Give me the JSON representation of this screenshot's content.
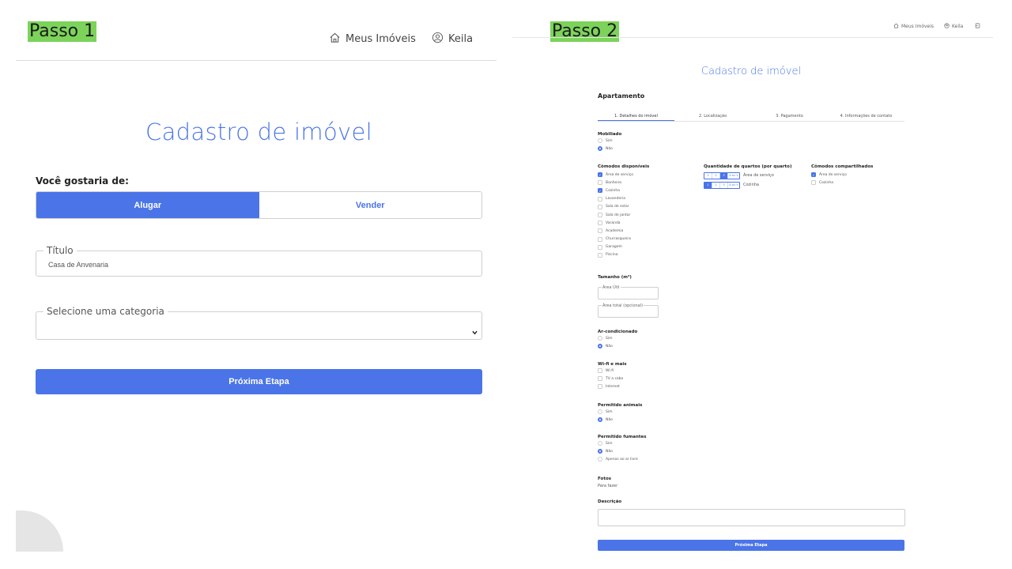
{
  "left": {
    "step_label": "Passo 1",
    "nav": {
      "home_label": "Meus Imóveis",
      "user_label": "Keila"
    },
    "title": "Cadastro de imóvel",
    "question": "Você gostaria de:",
    "toggle": {
      "rent": "Alugar",
      "sell": "Vender"
    },
    "titulo": {
      "legend": "Título",
      "value": "Casa de Anvenaria"
    },
    "categoria": {
      "legend": "Selecione uma categoria",
      "value": ""
    },
    "next_button": "Próxima Etapa"
  },
  "right": {
    "step_label": "Passo 2",
    "nav": {
      "home_label": "Meus Imóveis",
      "user_label": "Keila"
    },
    "title": "Cadastro de imóvel",
    "subtitle": "Apartamento",
    "tabs": [
      "1. Detalhes do imóvel",
      "2. Localização",
      "3. Pagamento",
      "4. Informações de contato"
    ],
    "mobiliado": {
      "label": "Mobiliado",
      "options": [
        "Sim",
        "Não"
      ],
      "selected": 1
    },
    "comodos": {
      "label": "Cômodos disponíveis",
      "items": [
        {
          "label": "Área de serviço",
          "checked": true
        },
        {
          "label": "Banheiro",
          "checked": false
        },
        {
          "label": "Cozinha",
          "checked": true
        },
        {
          "label": "Lavanderia",
          "checked": false
        },
        {
          "label": "Sala de estar",
          "checked": false
        },
        {
          "label": "Sala de jantar",
          "checked": false
        },
        {
          "label": "Varanda",
          "checked": false
        },
        {
          "label": "Academia",
          "checked": false
        },
        {
          "label": "Churrasqueira",
          "checked": false
        },
        {
          "label": "Garagem",
          "checked": false
        },
        {
          "label": "Piscina",
          "checked": false
        }
      ]
    },
    "quartos": {
      "label": "Quantidade de quartos (por quarto)",
      "rows": [
        {
          "label": "Área de serviço",
          "options": [
            "1",
            "2",
            "3",
            "4 ou +"
          ],
          "selected": 2
        },
        {
          "label": "Cozinha",
          "options": [
            "1",
            "2",
            "3",
            "4 ou +"
          ],
          "selected": 0
        }
      ]
    },
    "compartilhados": {
      "label": "Cômodos compartilhados",
      "items": [
        {
          "label": "Área de serviço",
          "checked": true
        },
        {
          "label": "Cozinha",
          "checked": false
        }
      ]
    },
    "tamanho": {
      "label": "Tamanho (m²)",
      "util": "Área Útil",
      "total": "Área total (opcional)"
    },
    "ar": {
      "label": "Ar-condicionado",
      "options": [
        "Sim",
        "Não"
      ],
      "selected": 1
    },
    "wifi": {
      "label": "Wi-fi e mais",
      "items": [
        {
          "label": "Wi-fi",
          "checked": false
        },
        {
          "label": "TV a cabo",
          "checked": false
        },
        {
          "label": "Internet",
          "checked": false
        }
      ]
    },
    "animais": {
      "label": "Permitido animais",
      "options": [
        "Sim",
        "Não"
      ],
      "selected": 1
    },
    "fumantes": {
      "label": "Permitido fumantes",
      "options": [
        "Sim",
        "Não",
        "Apenas ao ar livre"
      ],
      "selected": 1
    },
    "fotos": {
      "label": "Fotos",
      "text": "Para fazer"
    },
    "descricao": {
      "label": "Descrição"
    },
    "next_button": "Próxima Etapa"
  },
  "colors": {
    "accent": "#4a74e8",
    "step_highlight": "#7cd35a"
  }
}
